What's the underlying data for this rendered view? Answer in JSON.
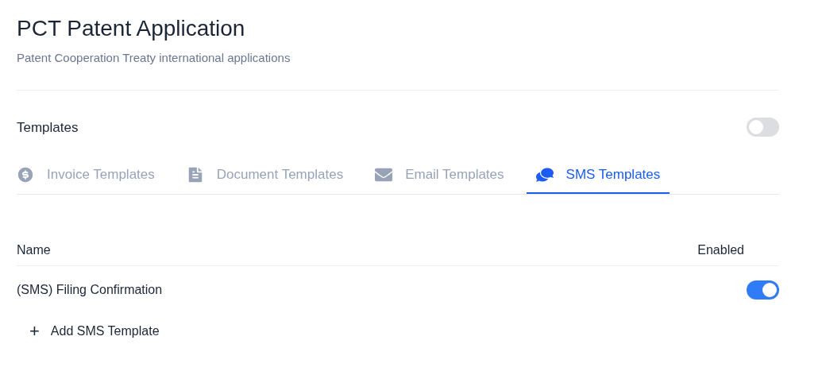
{
  "header": {
    "title": "PCT Patent Application",
    "subtitle": "Patent Cooperation Treaty international applications"
  },
  "section": {
    "title": "Templates",
    "on": false
  },
  "tabs": [
    {
      "label": "Invoice Templates",
      "kind": "invoice",
      "selected": false
    },
    {
      "label": "Document Templates",
      "kind": "document",
      "selected": false
    },
    {
      "label": "Email Templates",
      "kind": "email",
      "selected": false
    },
    {
      "label": "SMS Templates",
      "kind": "sms",
      "selected": true
    }
  ],
  "table": {
    "columns": [
      "Name",
      "Enabled"
    ],
    "rows": [
      {
        "name": "(SMS) Filing Confirmation",
        "on": true
      }
    ]
  },
  "add_button": {
    "icon": "+",
    "label": "Add SMS Template"
  }
}
